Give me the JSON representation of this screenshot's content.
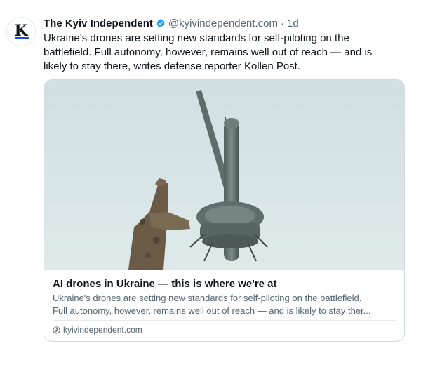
{
  "post": {
    "author_name": "The Kyiv Independent",
    "handle": "@kyivindependent.com",
    "separator": "·",
    "timestamp": "1d",
    "avatar_letter": "K",
    "text_lines": [
      "Ukraine’s drones are setting new standards for self-piloting on the",
      "battlefield. Full autonomy, however, remains well out of reach — and is",
      "likely to stay there, writes defense reporter Kollen Post."
    ]
  },
  "card": {
    "title": "AI drones in Ukraine — this is where we're at",
    "description_lines": [
      "Ukraine's drones are setting new standards for self-piloting on the battlefield.",
      "Full autonomy, however, remains well out of reach — and is likely to stay ther..."
    ],
    "domain": "kyivindependent.com"
  },
  "colors": {
    "verified": "#1d9bf0",
    "avatar_accent": "#1a4bd6",
    "secondary_text": "#536471",
    "border": "#cfd9de"
  },
  "icons": {
    "verified": "verified-check-icon",
    "link": "link-icon"
  }
}
